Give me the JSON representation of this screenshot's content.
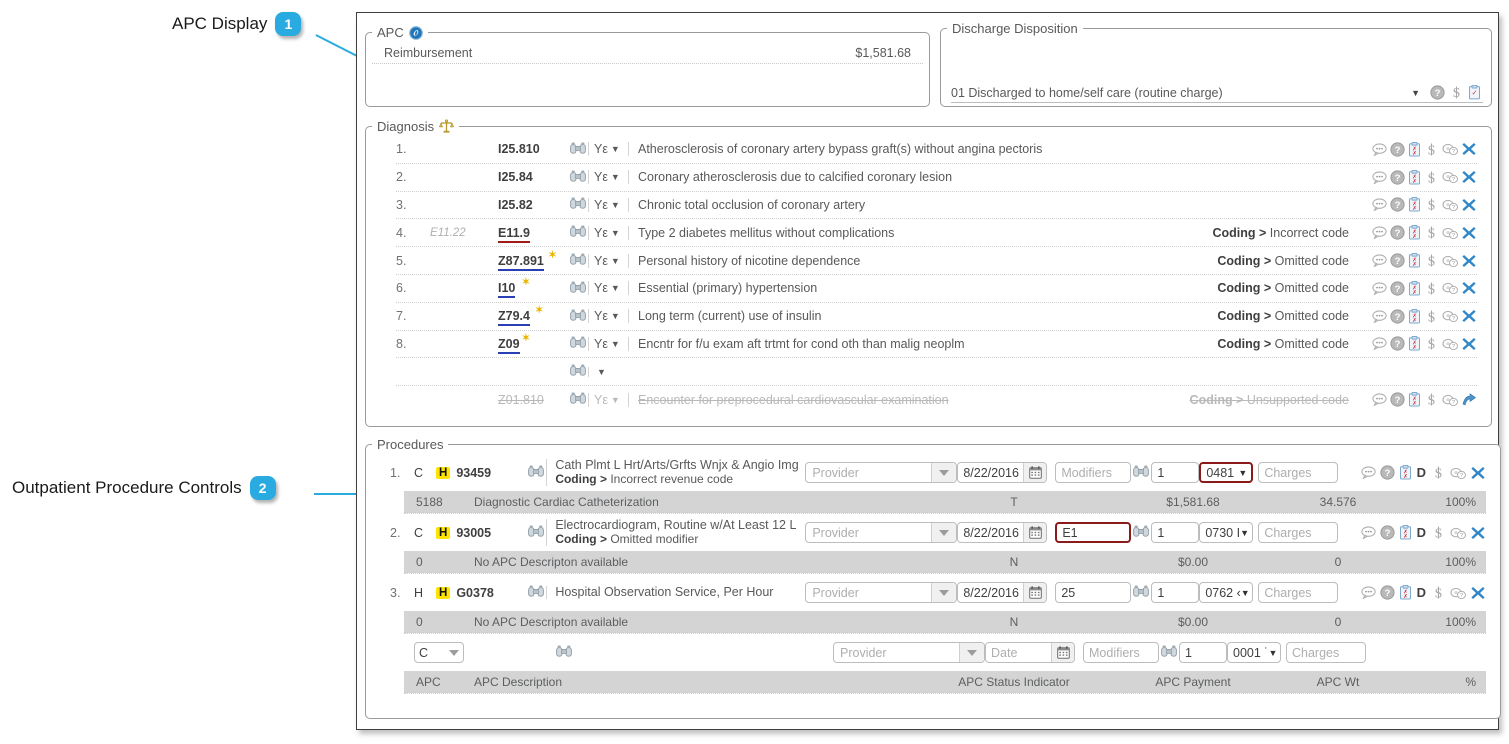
{
  "callouts": [
    {
      "id": "1",
      "label": "APC Display"
    },
    {
      "id": "2",
      "label": "Outpatient Procedure Controls"
    }
  ],
  "apc_panel": {
    "legend": "APC",
    "icon": "apc-blue-circle-icon",
    "reimbursement_label": "Reimbursement",
    "reimbursement_value": "$1,581.68"
  },
  "discharge_panel": {
    "legend": "Discharge Disposition",
    "value": "01 Discharged to home/self care (routine charge)",
    "caret": "▼",
    "icons": [
      "help-icon",
      "dollar-icon",
      "clipboard-icon"
    ]
  },
  "diagnosis_panel": {
    "legend": "Diagnosis",
    "icon": "scales-icon",
    "poa_value": "Yε",
    "rows": [
      {
        "num": "1.",
        "original": "",
        "code": "I25.810",
        "underline": "none",
        "star": false,
        "poa": "Yε",
        "description": "Atherosclerosis of coronary artery bypass graft(s) without angina pectoris",
        "message_prefix": "",
        "message": "",
        "struck": false
      },
      {
        "num": "2.",
        "original": "",
        "code": "I25.84",
        "underline": "none",
        "star": false,
        "poa": "Yε",
        "description": "Coronary atherosclerosis due to calcified coronary lesion",
        "message_prefix": "",
        "message": "",
        "struck": false
      },
      {
        "num": "3.",
        "original": "",
        "code": "I25.82",
        "underline": "none",
        "star": false,
        "poa": "Yε",
        "description": "Chronic total occlusion of coronary artery",
        "message_prefix": "",
        "message": "",
        "struck": false
      },
      {
        "num": "4.",
        "original": "E11.22",
        "code": "E11.9",
        "underline": "red",
        "star": false,
        "poa": "Yε",
        "description": "Type 2 diabetes mellitus without complications",
        "message_prefix": "Coding >",
        "message": "Incorrect code",
        "struck": false
      },
      {
        "num": "5.",
        "original": "",
        "code": "Z87.891",
        "underline": "blue",
        "star": true,
        "poa": "Yε",
        "description": "Personal history of nicotine dependence",
        "message_prefix": "Coding >",
        "message": "Omitted code",
        "struck": false
      },
      {
        "num": "6.",
        "original": "",
        "code": "I10",
        "underline": "blue",
        "star": true,
        "poa": "Yε",
        "description": "Essential (primary) hypertension",
        "message_prefix": "Coding >",
        "message": "Omitted code",
        "struck": false
      },
      {
        "num": "7.",
        "original": "",
        "code": "Z79.4",
        "underline": "blue",
        "star": true,
        "poa": "Yε",
        "description": "Long term (current) use of insulin",
        "message_prefix": "Coding >",
        "message": "Omitted code",
        "struck": false
      },
      {
        "num": "8.",
        "original": "",
        "code": "Z09",
        "underline": "blue",
        "star": true,
        "poa": "Yε",
        "description": "Encntr for f/u exam aft trtmt for cond oth than malig neoplm",
        "message_prefix": "Coding >",
        "message": "Omitted code",
        "struck": false
      }
    ],
    "empty_row": {
      "num": "",
      "code": "",
      "poa": "",
      "description": ""
    },
    "struck_row": {
      "num": "",
      "code": "Z01.810",
      "poa": "Yε",
      "description": "Encounter for preprocedural cardiovascular examination",
      "message_prefix": "Coding >",
      "message": "Unsupported code"
    }
  },
  "procedures_panel": {
    "legend": "Procedures",
    "rows": [
      {
        "num": "1.",
        "type": "C",
        "badge": "H",
        "code": "93459",
        "description": "Cath Plmt L Hrt/Arts/Grfts Wnjx & Angio Img",
        "message_prefix": "Coding >",
        "message": "Incorrect revenue code",
        "provider_placeholder": "Provider",
        "provider_value": "",
        "date": "8/22/2016",
        "modifiers_placeholder": "Modifiers",
        "modifiers_value": "",
        "modifiers_error": false,
        "quantity": "1",
        "revenue_code": "0481",
        "revenue_error": true,
        "charges_placeholder": "Charges",
        "charges_value": "",
        "apc": "5188",
        "apc_description": "Diagnostic Cardiac Catheterization",
        "status_indicator": "T",
        "apc_payment": "$1,581.68",
        "apc_wt": "34.576",
        "percent": "100%"
      },
      {
        "num": "2.",
        "type": "C",
        "badge": "H",
        "code": "93005",
        "description": "Electrocardiogram, Routine w/At Least 12 L",
        "message_prefix": "Coding >",
        "message": "Omitted modifier",
        "provider_placeholder": "Provider",
        "provider_value": "",
        "date": "8/22/2016",
        "modifiers_placeholder": "Modifiers",
        "modifiers_value": "E1",
        "modifiers_error": true,
        "quantity": "1",
        "revenue_code": "0730 I",
        "revenue_error": false,
        "charges_placeholder": "Charges",
        "charges_value": "",
        "apc": "0",
        "apc_description": "No APC Descripton available",
        "status_indicator": "N",
        "apc_payment": "$0.00",
        "apc_wt": "0",
        "percent": "100%"
      },
      {
        "num": "3.",
        "type": "H",
        "badge": "H",
        "code": "G0378",
        "description": "Hospital Observation Service, Per Hour",
        "message_prefix": "",
        "message": "",
        "provider_placeholder": "Provider",
        "provider_value": "",
        "date": "8/22/2016",
        "modifiers_placeholder": "Modifiers",
        "modifiers_value": "25",
        "modifiers_error": false,
        "quantity": "1",
        "revenue_code": "0762 ‹",
        "revenue_error": false,
        "charges_placeholder": "Charges",
        "charges_value": "",
        "apc": "0",
        "apc_description": "No APC Descripton available",
        "status_indicator": "N",
        "apc_payment": "$0.00",
        "apc_wt": "0",
        "percent": "100%"
      }
    ],
    "new_row": {
      "type_value": "C",
      "provider_placeholder": "Provider",
      "date_placeholder": "Date",
      "modifiers_placeholder": "Modifiers",
      "quantity": "1",
      "revenue_code": "0001 ˙",
      "charges_placeholder": "Charges"
    },
    "column_headers": {
      "apc": "APC",
      "apc_description": "APC Description",
      "status_indicator": "APC Status Indicator",
      "apc_payment": "APC Payment",
      "apc_wt": "APC Wt",
      "percent": "%"
    },
    "row_icons": [
      "comment-icon",
      "help-icon",
      "clipboard-icon",
      "d-letter-icon",
      "dollar-icon",
      "tag-question-icon",
      "delete-x-icon"
    ]
  },
  "colors": {
    "accent": "#29ABE2",
    "error_red": "#8b1a1a",
    "underline_blue": "#2a3fb5",
    "badge_yellow": "#FFE400",
    "subrow_gray": "#d4d4d4"
  }
}
